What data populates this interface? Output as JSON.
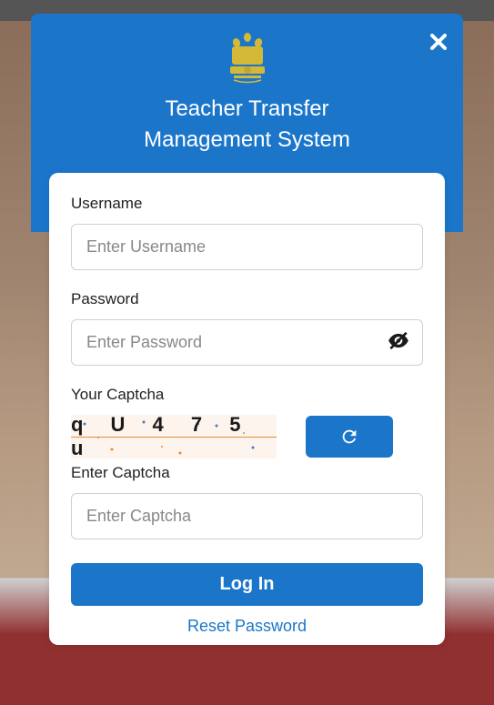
{
  "header": {
    "title_line1": "Teacher Transfer",
    "title_line2": "Management System"
  },
  "form": {
    "username_label": "Username",
    "username_placeholder": "Enter Username",
    "password_label": "Password",
    "password_placeholder": "Enter Password",
    "captcha_label": "Your Captcha",
    "captcha_value": "q U 4 7 5 u",
    "enter_captcha_label": "Enter Captcha",
    "enter_captcha_placeholder": "Enter Captcha",
    "login_button": "Log In",
    "reset_link": "Reset Password"
  },
  "colors": {
    "primary": "#1b76ca"
  }
}
